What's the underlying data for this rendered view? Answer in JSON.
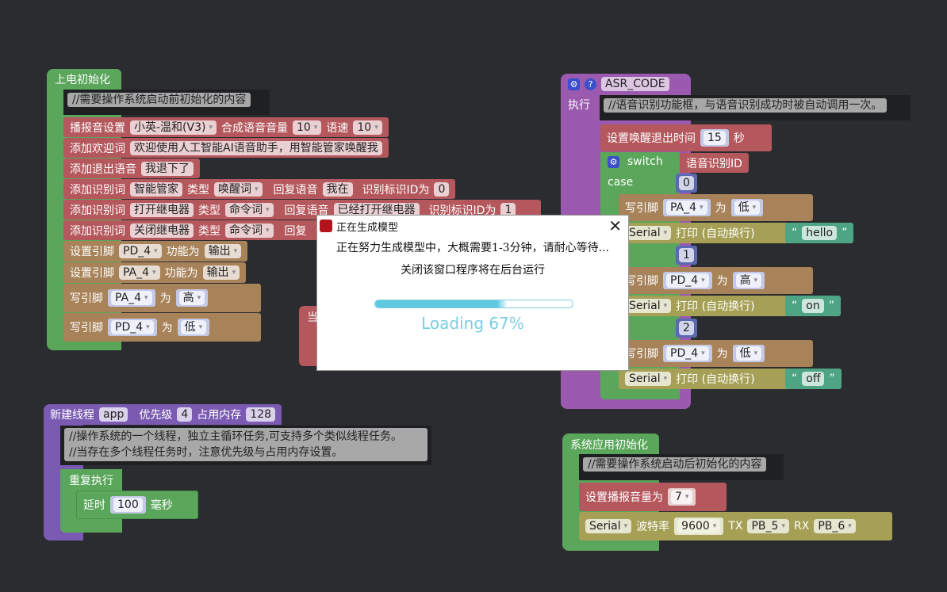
{
  "block1": {
    "hat": "上电初始化",
    "comment": "//需要操作系统启动前初始化的内容",
    "rows": [
      {
        "label": "播报音设置",
        "voice": "小英-温和(V3)",
        "vol_label": "合成语音音量",
        "vol": "10",
        "speed_label": "语速",
        "speed": "10"
      },
      {
        "label": "添加欢迎词",
        "text": "欢迎使用人工智能AI语音助手，用智能管家唤醒我"
      },
      {
        "label": "添加退出语音",
        "text": "我退下了"
      },
      {
        "label": "添加识别词",
        "word": "智能管家",
        "type_label": "类型",
        "type": "唤醒词",
        "reply_label": "回复语音",
        "reply": "我在",
        "id_label": "识别标识ID为",
        "id": "0"
      },
      {
        "label": "添加识别词",
        "word": "打开继电器",
        "type_label": "类型",
        "type": "命令词",
        "reply_label": "回复语音",
        "reply": "已经打开继电器",
        "id_label": "识别标识ID为",
        "id": "1"
      },
      {
        "label": "添加识别词",
        "word": "关闭继电器",
        "type_label": "类型",
        "type": "命令词",
        "reply_label": "回复"
      }
    ],
    "pins": [
      {
        "label": "设置引脚",
        "pin": "PD_4",
        "func_label": "功能为",
        "func": "输出"
      },
      {
        "label": "设置引脚",
        "pin": "PA_4",
        "func_label": "功能为",
        "func": "输出"
      }
    ],
    "writes": [
      {
        "label": "写引脚",
        "pin": "PA_4",
        "as": "为",
        "val": "高"
      },
      {
        "label": "写引脚",
        "pin": "PD_4",
        "as": "为",
        "val": "低"
      }
    ],
    "hidden_block_label": "当"
  },
  "block2": {
    "title": "ASR_CODE",
    "exec": "执行",
    "comment": "//语音识别功能框，与语音识别成功时被自动调用一次。",
    "timeout_label": "设置唤醒退出时间",
    "timeout": "15",
    "timeout_unit": "秒",
    "switch_label": "switch",
    "switch_var": "语音识别ID",
    "case_label": "case",
    "cases": [
      {
        "value": "0",
        "pin": "PA_4",
        "val": "低",
        "serial": "Serial",
        "print": "打印 (自动换行)",
        "text": "hello"
      },
      {
        "value": "1",
        "pin": "PD_4",
        "val": "高",
        "serial": "Serial",
        "print": "打印 (自动换行)",
        "text": "on"
      },
      {
        "value": "2",
        "pin": "PD_4",
        "val": "低",
        "serial": "Serial",
        "print": "打印 (自动换行)",
        "text": "off"
      }
    ],
    "write_label": "写引脚",
    "as": "为"
  },
  "block3": {
    "label": "新建线程",
    "name": "app",
    "prio_label": "优先级",
    "prio": "4",
    "mem_label": "占用内存",
    "mem": "128",
    "comment1": "//操作系统的一个线程，独立主循环任务,可支持多个类似线程任务。",
    "comment2": "//当存在多个线程任务时，注意优先级与占用内存设置。",
    "loop": "重复执行",
    "delay": "延时",
    "delay_val": "100",
    "delay_unit": "毫秒"
  },
  "block4": {
    "hat": "系统应用初始化",
    "comment": "//需要操作系统启动后初始化的内容",
    "vol_label": "设置播报音量为",
    "vol": "7",
    "serial": "Serial",
    "baud_label": "波特率",
    "baud": "9600",
    "tx_label": "TX",
    "tx": "PB_5",
    "rx_label": "RX",
    "rx": "PB_6"
  },
  "dialog": {
    "title": "正在生成模型",
    "line1": "正在努力生成模型中，大概需要1-3分钟，请耐心等待...",
    "line2": "关闭该窗口程序将在后台运行",
    "progress": 0.67,
    "loading": "Loading 67%"
  }
}
